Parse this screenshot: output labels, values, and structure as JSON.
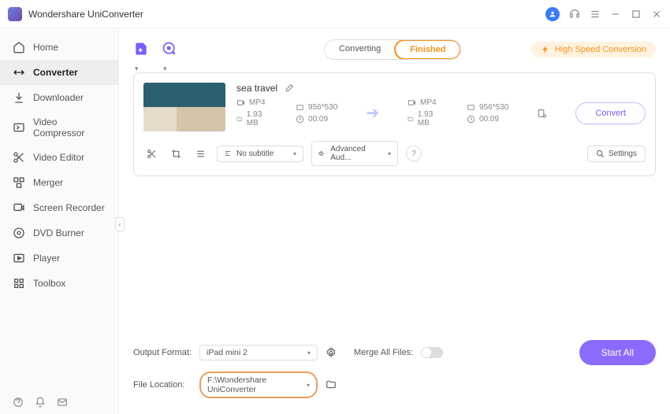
{
  "app": {
    "title": "Wondershare UniConverter"
  },
  "sidebar": {
    "items": [
      {
        "label": "Home"
      },
      {
        "label": "Converter"
      },
      {
        "label": "Downloader"
      },
      {
        "label": "Video Compressor"
      },
      {
        "label": "Video Editor"
      },
      {
        "label": "Merger"
      },
      {
        "label": "Screen Recorder"
      },
      {
        "label": "DVD Burner"
      },
      {
        "label": "Player"
      },
      {
        "label": "Toolbox"
      }
    ]
  },
  "tabs": {
    "converting": "Converting",
    "finished": "Finished"
  },
  "hsc": "High Speed Conversion",
  "file": {
    "title": "sea travel",
    "src": {
      "format": "MP4",
      "resolution": "956*530",
      "size": "1.93 MB",
      "duration": "00:09"
    },
    "dst": {
      "format": "MP4",
      "resolution": "956*530",
      "size": "1.93 MB",
      "duration": "00:09"
    },
    "convert": "Convert",
    "subtitle": "No subtitle",
    "audio": "Advanced Aud...",
    "settings": "Settings"
  },
  "bottom": {
    "output_format_label": "Output Format:",
    "output_format_value": "iPad mini 2",
    "file_location_label": "File Location:",
    "file_location_value": "F:\\Wondershare UniConverter",
    "merge_label": "Merge All Files:",
    "start_all": "Start All"
  }
}
